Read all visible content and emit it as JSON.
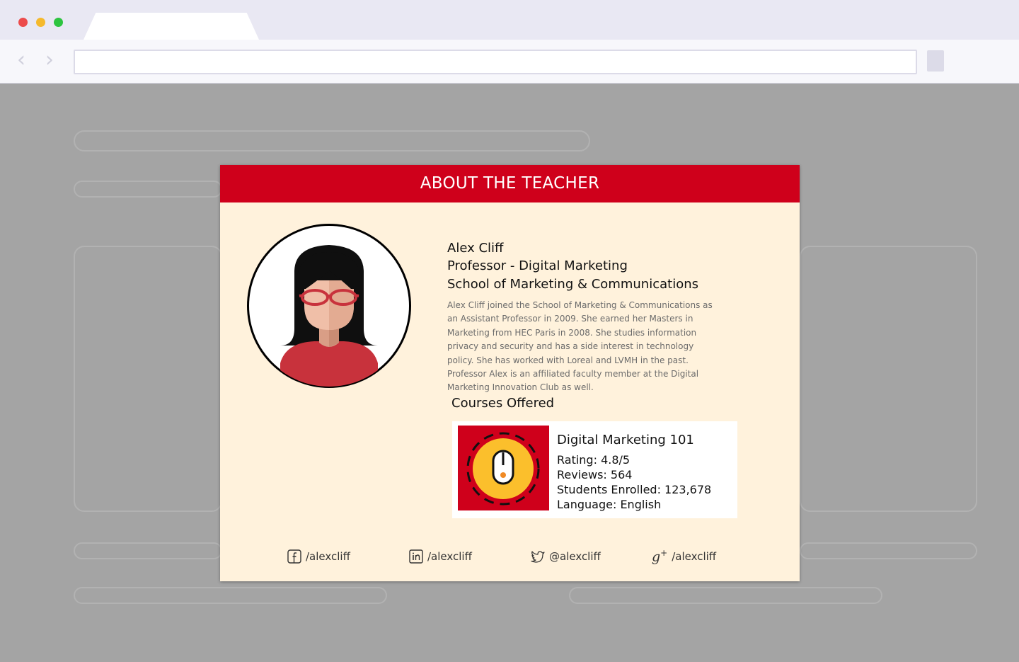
{
  "modal": {
    "title": "ABOUT THE TEACHER"
  },
  "teacher": {
    "name": "Alex Cliff",
    "position": "Professor - Digital Marketing",
    "school": "School of Marketing & Communications",
    "bio": "Alex Cliff joined the School of Marketing & Communications as an Assistant Professor in 2009. She earned her Masters in Marketing from HEC Paris in 2008. She studies information privacy and security and has a side interest in technology policy. She has worked with Loreal and LVMH in the past. Professor Alex is an affiliated faculty member at the Digital Marketing Innovation Club as well."
  },
  "courses": {
    "heading": "Courses Offered",
    "items": [
      {
        "title": "Digital Marketing 101",
        "rating": "Rating: 4.8/5",
        "reviews": "Reviews: 564",
        "students": "Students Enrolled: 123,678",
        "language": "Language: English"
      }
    ]
  },
  "social": [
    {
      "icon": "facebook-icon",
      "handle": "/alexcliff"
    },
    {
      "icon": "linkedin-icon",
      "handle": "/alexcliff"
    },
    {
      "icon": "twitter-icon",
      "handle": "@alexcliff"
    },
    {
      "icon": "google-plus-icon",
      "handle": "/alexcliff"
    }
  ],
  "colors": {
    "accent": "#cf001b",
    "modal_background": "#fff2dc",
    "page_overlay": "#a4a4a4",
    "course_icon_yellow": "#fbbf2c"
  }
}
